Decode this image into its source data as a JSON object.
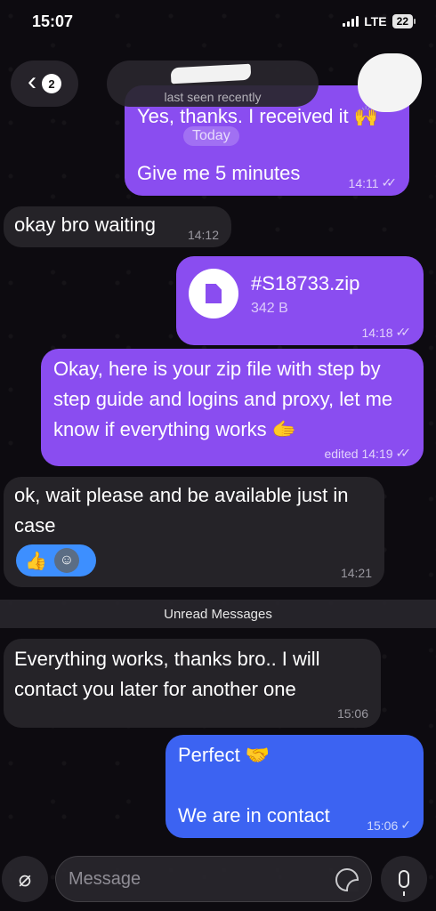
{
  "status_bar": {
    "time": "15:07",
    "network": "LTE",
    "battery": "22"
  },
  "header": {
    "back_count": "2",
    "subtitle": "last seen recently"
  },
  "messages": [
    {
      "side": "out",
      "text": "Yes, thanks. I received it 🙌"
    },
    {
      "date_chip": "Today"
    },
    {
      "side": "out",
      "text": "Give me 5 minutes",
      "time": "14:11"
    },
    {
      "side": "in",
      "text": "okay bro waiting",
      "time": "14:12"
    },
    {
      "side": "out",
      "file_name": "#S18733.zip",
      "file_size": "342 B",
      "time": "14:18"
    },
    {
      "side": "out",
      "text": "Okay, here is your zip file with step by step guide and logins and proxy, let me know if everything works 🫱",
      "meta": "edited 14:19"
    },
    {
      "side": "in",
      "text": "ok, wait please and be available just in case",
      "time": "14:21",
      "reaction": "👍"
    },
    {
      "unread_divider": "Unread Messages"
    },
    {
      "side": "in",
      "text": "Everything works, thanks bro.. I will contact you later for another one",
      "time": "15:06"
    },
    {
      "side": "out",
      "line1": "Perfect 🤝",
      "line2": "We are in contact",
      "time": "15:06"
    }
  ],
  "composer": {
    "placeholder": "Message"
  },
  "colors": {
    "outgoing": "#8a4df0",
    "outgoing_last": "#3c63f2",
    "incoming": "#26242a",
    "reaction": "#3d8fff"
  }
}
